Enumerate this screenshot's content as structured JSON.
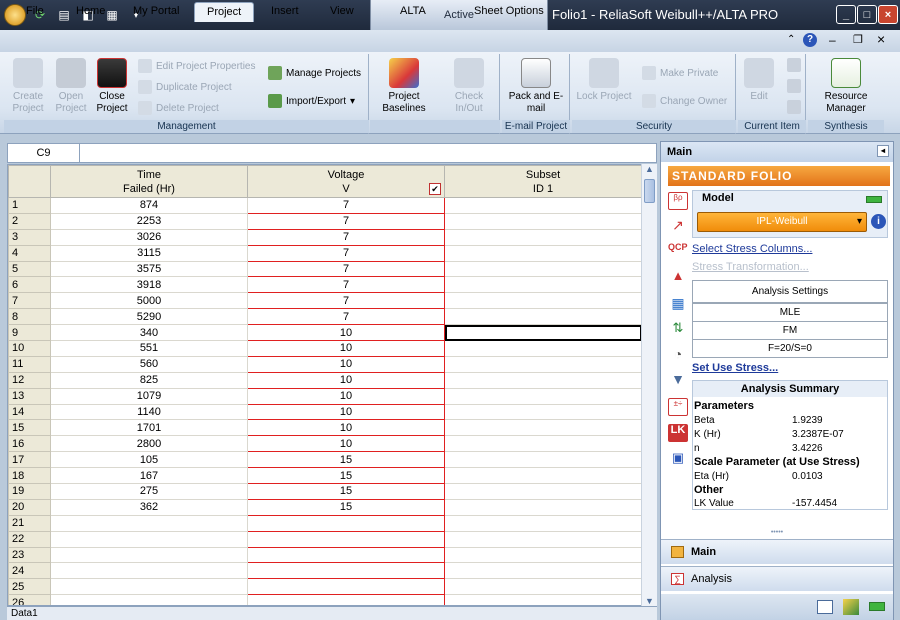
{
  "window": {
    "title": "Folio1 - ReliaSoft Weibull++/ALTA PRO",
    "context_tab": "Active"
  },
  "tabs": [
    "File",
    "Home",
    "My Portal",
    "Project",
    "Insert",
    "View",
    "ALTA",
    "Sheet Options"
  ],
  "selected_tab": "Project",
  "ribbon": {
    "management": {
      "label": "Management",
      "create": "Create Project",
      "open": "Open Project",
      "close": "Close Project",
      "edit_props": "Edit Project Properties",
      "duplicate": "Duplicate Project",
      "delete": "Delete Project",
      "manage": "Manage Projects",
      "import_export": "Import/Export",
      "baselines": "Project Baselines",
      "check": "Check In/Out"
    },
    "email": {
      "label": "E-mail Project",
      "pack": "Pack and E-mail"
    },
    "security": {
      "label": "Security",
      "lock": "Lock Project",
      "make_private": "Make Private",
      "change_owner": "Change Owner"
    },
    "current_item": {
      "label": "Current Item",
      "edit": "Edit"
    },
    "synthesis": {
      "label": "Synthesis",
      "resource": "Resource Manager"
    }
  },
  "sheet": {
    "cell_ref": "C9",
    "columns": [
      {
        "line1": "Time",
        "line2": "Failed (Hr)"
      },
      {
        "line1": "Voltage",
        "line2": "V"
      },
      {
        "line1": "Subset",
        "line2": "ID 1"
      }
    ],
    "rows": [
      [
        "874",
        "7",
        ""
      ],
      [
        "2253",
        "7",
        ""
      ],
      [
        "3026",
        "7",
        ""
      ],
      [
        "3115",
        "7",
        ""
      ],
      [
        "3575",
        "7",
        ""
      ],
      [
        "3918",
        "7",
        ""
      ],
      [
        "5000",
        "7",
        ""
      ],
      [
        "5290",
        "7",
        ""
      ],
      [
        "340",
        "10",
        ""
      ],
      [
        "551",
        "10",
        ""
      ],
      [
        "560",
        "10",
        ""
      ],
      [
        "825",
        "10",
        ""
      ],
      [
        "1079",
        "10",
        ""
      ],
      [
        "1140",
        "10",
        ""
      ],
      [
        "1701",
        "10",
        ""
      ],
      [
        "2800",
        "10",
        ""
      ],
      [
        "105",
        "15",
        ""
      ],
      [
        "167",
        "15",
        ""
      ],
      [
        "275",
        "15",
        ""
      ],
      [
        "362",
        "15",
        ""
      ],
      [
        "",
        "",
        ""
      ],
      [
        "",
        "",
        ""
      ],
      [
        "",
        "",
        ""
      ],
      [
        "",
        "",
        ""
      ],
      [
        "",
        "",
        ""
      ],
      [
        "",
        "",
        ""
      ]
    ],
    "sheet_tab": "Data1"
  },
  "panel": {
    "header": "Main",
    "folio": "STANDARD FOLIO",
    "model_label": "Model",
    "model_value": "IPL-Weibull",
    "select_stress": "Select Stress Columns...",
    "stress_transform": "Stress Transformation...",
    "settings_title": "Analysis Settings",
    "settings": [
      "MLE",
      "FM",
      "F=20/S=0"
    ],
    "set_use_stress": "Set Use Stress...",
    "summary_title": "Analysis Summary",
    "parameters_h": "Parameters",
    "params": [
      {
        "name": "Beta",
        "value": "1.9239"
      },
      {
        "name": "K (Hr)",
        "value": "3.2387E-07"
      },
      {
        "name": "n",
        "value": "3.4226"
      }
    ],
    "scale_h": "Scale Parameter (at Use Stress)",
    "scale": [
      {
        "name": "Eta (Hr)",
        "value": "0.0103"
      }
    ],
    "other_h": "Other",
    "other": [
      {
        "name": "LK Value",
        "value": "-157.4454"
      }
    ],
    "nav_main": "Main",
    "nav_analysis": "Analysis"
  },
  "colors": {
    "accent": "#f08c0a",
    "title_bar": "#1f2a3c",
    "voltage_border": "#e02020"
  }
}
